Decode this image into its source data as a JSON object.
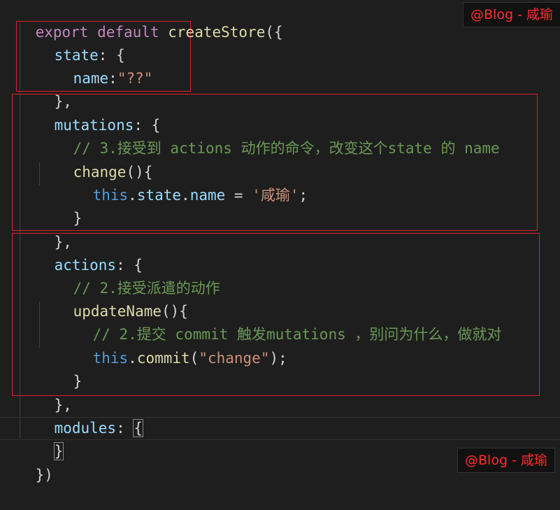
{
  "code": {
    "l1": {
      "export": "export",
      "default": "default",
      "fn": "createStore",
      "open": "({"
    },
    "l2": {
      "key": "state",
      "rest": ": {"
    },
    "l3": {
      "key": "name",
      "colon": ":",
      "val": "\"??\""
    },
    "l4": {
      "text": "},"
    },
    "l5": {
      "key": "mutations",
      "rest": ": {"
    },
    "l6": {
      "comment": "// 3.接受到 actions 动作的命令，改变这个state 的 name"
    },
    "l7": {
      "fn": "change",
      "rest": "(){"
    },
    "l8": {
      "this": "this",
      "dot1": ".",
      "p1": "state",
      "dot2": ".",
      "p2": "name",
      "eq": " = ",
      "val": "'咸瑜'",
      "end": ";"
    },
    "l9": {
      "text": "}"
    },
    "l10": {
      "text": "},"
    },
    "l11": {
      "key": "actions",
      "rest": ": {"
    },
    "l12": {
      "comment": "// 2.接受派遣的动作"
    },
    "l13": {
      "fn": "updateName",
      "rest": "(){"
    },
    "l14": {
      "comment": "// 2.提交 commit 触发mutations ，别问为什么，做就对"
    },
    "l15": {
      "this": "this",
      "dot": ".",
      "fn": "commit",
      "open": "(",
      "val": "\"change\"",
      "close": ");"
    },
    "l16": {
      "text": "}"
    },
    "l17": {
      "text": "},"
    },
    "l18": {
      "key": "modules",
      "colon": ": ",
      "brace": "{"
    },
    "l19": {
      "brace": "}"
    },
    "l20": {
      "text": "})"
    }
  },
  "watermark_top": "@Blog  - 咸瑜",
  "watermark_bottom": "@Blog  - 咸瑜",
  "colors": {
    "background": "#1e1e1e",
    "keyword": "#c586c0",
    "function": "#dcdcaa",
    "property": "#9cdcfe",
    "string": "#ce9178",
    "comment": "#6a9955",
    "this": "#569cd6",
    "highlight_box": "#e0202a",
    "watermark_text": "#ff2d2d"
  }
}
